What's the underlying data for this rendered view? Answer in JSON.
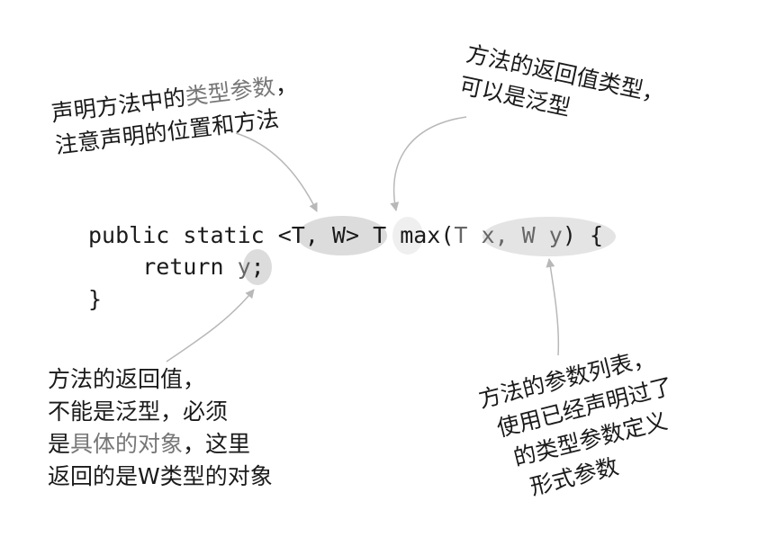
{
  "code": {
    "line1": {
      "prefix": "public static ",
      "type_params": "<T, W>",
      "space1": " ",
      "return_type": "T",
      "method_open": " max(",
      "params": "T x, W y",
      "close": ") {"
    },
    "line2": {
      "indent": "    return ",
      "ret_var": "y",
      "semi": ";"
    },
    "line3": "}"
  },
  "notes": {
    "top_left": {
      "line1_a": "声明方法中的",
      "line1_b": "类型参数",
      "line1_c": "，",
      "line2": "注意声明的位置和方法"
    },
    "top_right": {
      "line1": "方法的返回值类型，",
      "line2": "可以是泛型"
    },
    "bottom_left": {
      "line1": "方法的返回值，",
      "line2": "不能是泛型，必须",
      "line3_a": "是",
      "line3_b": "具体的对象",
      "line3_c": "，这里",
      "line4": "返回的是W类型的对象"
    },
    "bottom_right": {
      "line1": "方法的参数列表，",
      "line2": "使用已经声明过了",
      "line3": "的类型参数定义",
      "line4": "形式参数"
    }
  },
  "colors": {
    "highlight_fill": "#dcdcdc",
    "highlight_fill_light": "#efefef",
    "arrow_stroke": "#b8b8b8",
    "text": "#1a1a1a"
  }
}
